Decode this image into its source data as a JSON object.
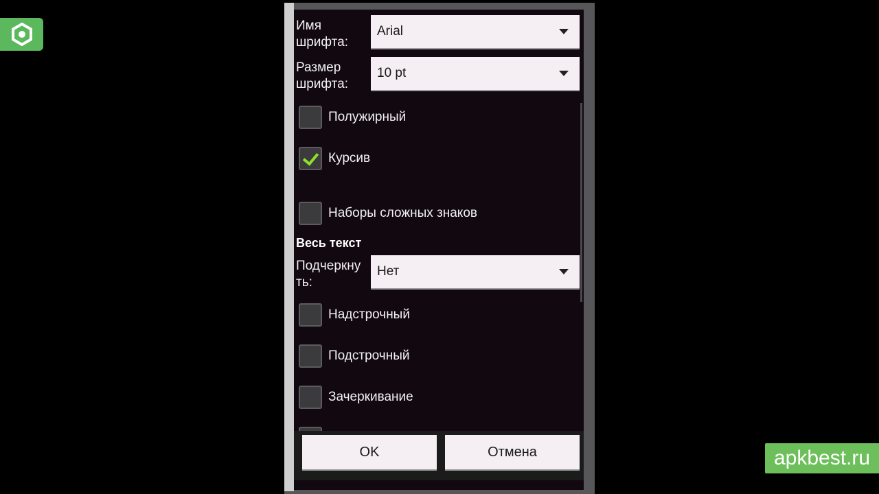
{
  "watermark": "apkbest.ru",
  "icons": {
    "logo": "hexagon-logo-icon",
    "dropdown": "triangle-down-icon",
    "check": "checkmark-icon"
  },
  "colors": {
    "accent_check": "#8ee02c",
    "watermark_bg": "#6cbf5a",
    "logo_bg": "#5cb85c"
  },
  "font_name": {
    "label_line1": "Имя",
    "label_line2": "шрифта:",
    "value": "Arial"
  },
  "font_size": {
    "label_line1": "Размер",
    "label_line2": "шрифта:",
    "value": "10 pt"
  },
  "checkboxes_top": [
    {
      "label": "Полужирный",
      "checked": false
    },
    {
      "label": "Курсив",
      "checked": true
    },
    {
      "label": "Наборы сложных знаков",
      "checked": false
    }
  ],
  "section": {
    "title": "Весь текст"
  },
  "underline": {
    "label_line1": "Подчеркну",
    "label_line2": "ть:",
    "value": "Нет"
  },
  "checkboxes_bottom": [
    {
      "label": "Надстрочный",
      "checked": false
    },
    {
      "label": "Подстрочный",
      "checked": false
    },
    {
      "label": "Зачеркивание",
      "checked": false
    }
  ],
  "buttons": {
    "ok": "OK",
    "cancel": "Отмена"
  }
}
